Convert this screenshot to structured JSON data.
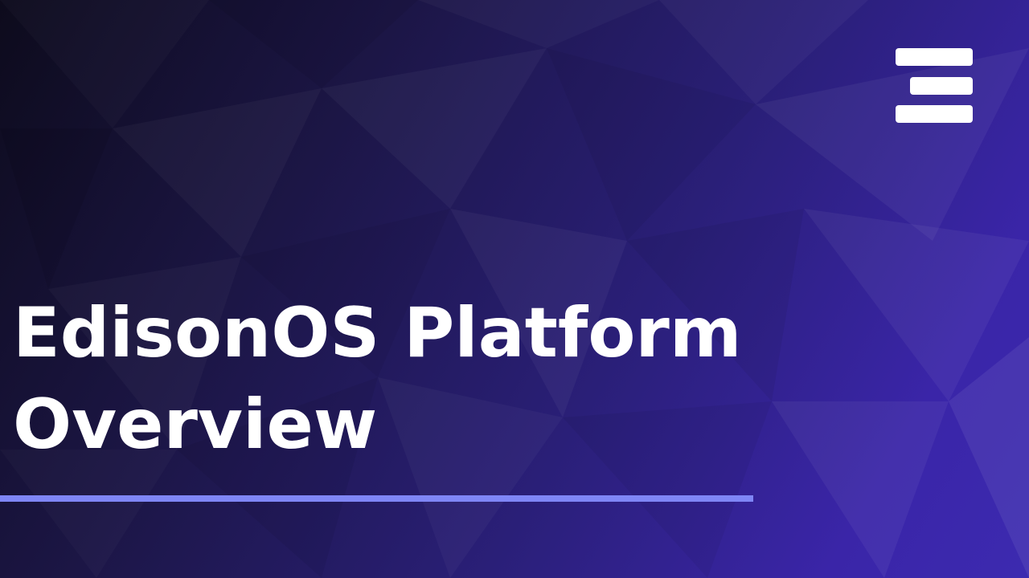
{
  "slide": {
    "title_line_1": "EdisonOS Platform",
    "title_line_2": "Overview"
  },
  "logo": {
    "icon": "three-bar-e-logo-icon"
  },
  "colors": {
    "background_dark": "#0d0b1c",
    "background_mid": "#2a1f78",
    "background_light": "#3c2ab0",
    "title_text": "#ffffff",
    "accent_line": "#7f86f6"
  }
}
